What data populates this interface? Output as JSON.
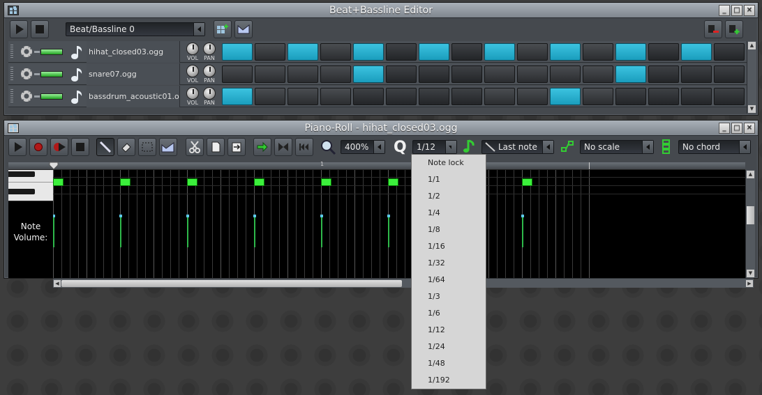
{
  "beat_editor": {
    "title": "Beat+Bassline Editor",
    "pattern_name": "Beat/Bassline 0",
    "tracks": [
      {
        "name": "hihat_closed03.ogg",
        "vol_label": "VOL",
        "pan_label": "PAN",
        "steps": [
          1,
          0,
          1,
          0,
          1,
          0,
          1,
          0,
          1,
          0,
          1,
          0,
          1,
          0,
          1,
          0
        ]
      },
      {
        "name": "snare07.ogg",
        "vol_label": "VOL",
        "pan_label": "PAN",
        "steps": [
          0,
          0,
          0,
          0,
          1,
          0,
          0,
          0,
          0,
          0,
          0,
          0,
          1,
          0,
          0,
          0
        ]
      },
      {
        "name": "bassdrum_acoustic01.ogg",
        "vol_label": "VOL",
        "pan_label": "PAN",
        "steps": [
          1,
          0,
          0,
          0,
          0,
          0,
          0,
          0,
          0,
          0,
          1,
          0,
          0,
          0,
          0,
          0
        ]
      }
    ]
  },
  "piano_roll": {
    "title": "Piano-Roll - hihat_closed03.ogg",
    "zoom": "400%",
    "quantize": "1/12",
    "note_length": "Last note",
    "scale": "No scale",
    "chord": "No chord",
    "ruler_marker": "1",
    "note_volume_label": "Note\nVolume:"
  },
  "quantize_menu": {
    "items": [
      "Note lock",
      "1/1",
      "1/2",
      "1/4",
      "1/8",
      "1/16",
      "1/32",
      "1/64",
      "1/3",
      "1/6",
      "1/12",
      "1/24",
      "1/48",
      "1/192"
    ]
  },
  "colors": {
    "step_on": "#3cc3e0",
    "note": "#3cf03c",
    "volume_bar": "#2eb84a"
  }
}
